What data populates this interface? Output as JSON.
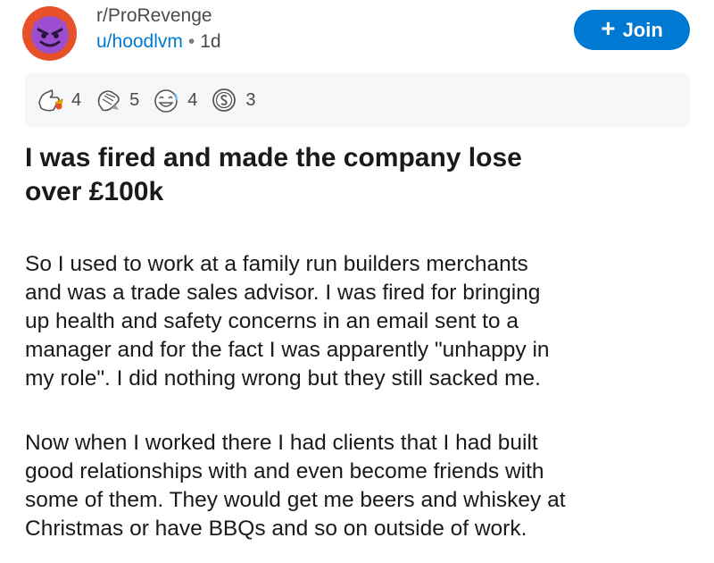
{
  "post": {
    "subreddit": "r/ProRevenge",
    "author": "u/hoodlvm",
    "separator": "•",
    "age": "1d",
    "join_label": "Join",
    "join_icon": "+",
    "awards": [
      {
        "icon": "wholesome-award-icon",
        "count": "4"
      },
      {
        "icon": "bravo-award-icon",
        "count": "5"
      },
      {
        "icon": "laughing-award-icon",
        "count": "4"
      },
      {
        "icon": "silver-coin-award-icon",
        "count": "3"
      }
    ],
    "title_line1": "I was fired and made the company lose",
    "title_line2": "over £100k",
    "paragraphs": [
      [
        "So I used to work at a family run builders merchants",
        "and was a trade sales advisor. I was fired for bringing",
        "up health and safety concerns in an email sent to a",
        "manager and for the fact I was apparently \"unhappy in",
        "my role\". I did nothing wrong but they still sacked me."
      ],
      [
        "Now when I worked there I had clients that I had built",
        "good relationships with and even become friends with",
        "some of them. They would get me beers and whiskey at",
        "Christmas or have BBQs and so on outside of work."
      ]
    ]
  },
  "colors": {
    "accent": "#0079d3",
    "avatar_ring": "#e8502a",
    "avatar_face": "#9b4fd0",
    "awards_bg": "#f6f7f8"
  }
}
